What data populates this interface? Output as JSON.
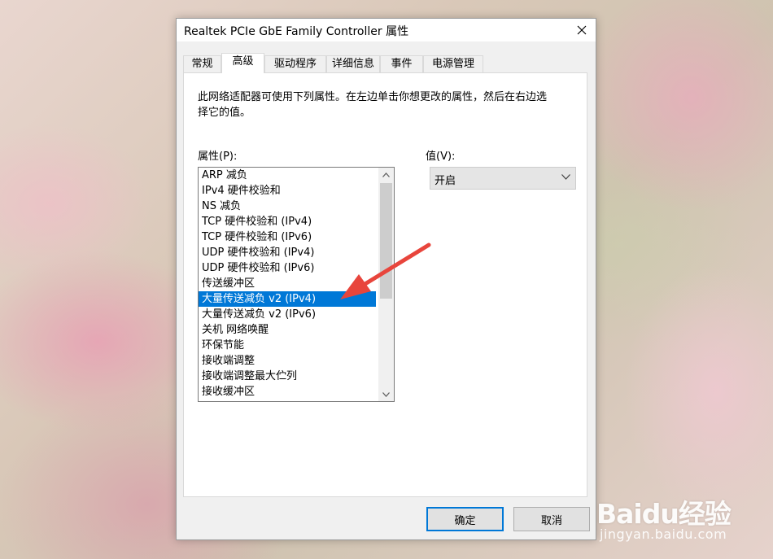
{
  "dialog": {
    "title": "Realtek PCIe GbE Family Controller 属性",
    "tabs": [
      {
        "label": "常规"
      },
      {
        "label": "高级"
      },
      {
        "label": "驱动程序"
      },
      {
        "label": "详细信息"
      },
      {
        "label": "事件"
      },
      {
        "label": "电源管理"
      }
    ],
    "active_tab": "高级",
    "description": "此网络适配器可使用下列属性。在左边单击你想更改的属性，然后在右边选择它的值。",
    "property_label": "属性(P):",
    "value_label": "值(V):",
    "properties": [
      "ARP 减负",
      "IPv4 硬件校验和",
      "NS 减负",
      "TCP 硬件校验和 (IPv4)",
      "TCP 硬件校验和 (IPv6)",
      "UDP 硬件校验和 (IPv4)",
      "UDP 硬件校验和 (IPv6)",
      "传送缓冲区",
      "大量传送减负 v2 (IPv4)",
      "大量传送减负 v2 (IPv6)",
      "关机 网络唤醒",
      "环保节能",
      "接收端调整",
      "接收端调整最大伫列",
      "接收缓冲区"
    ],
    "selected_property": "大量传送减负 v2 (IPv4)",
    "value": "开启",
    "ok_label": "确定",
    "cancel_label": "取消"
  },
  "icons": {
    "close": "close-icon",
    "scroll_up": "chevron-up-icon",
    "scroll_down": "chevron-down-icon",
    "dropdown": "chevron-down-icon"
  },
  "colors": {
    "selection": "#0078d7",
    "annotation_arrow": "#e8453c"
  },
  "watermark": {
    "logo": "Baidu经验",
    "url": "jingyan.baidu.com"
  }
}
